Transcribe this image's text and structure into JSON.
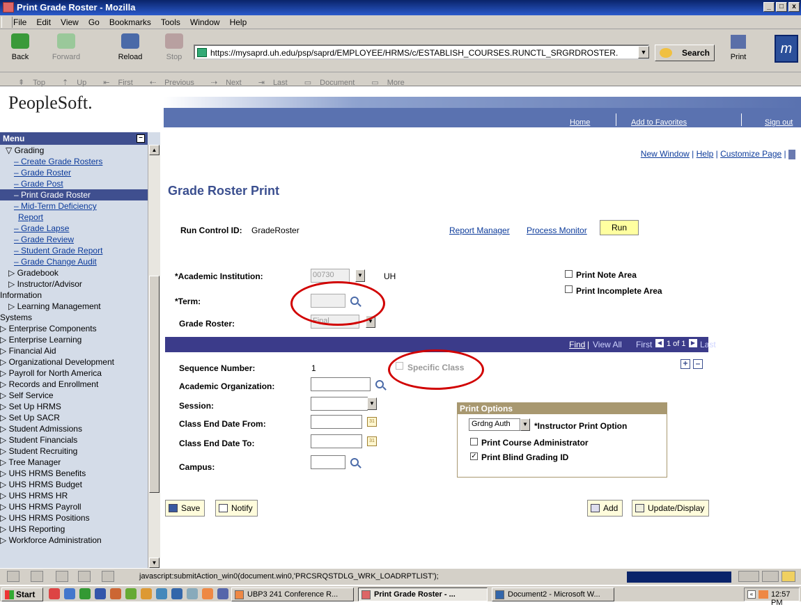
{
  "window": {
    "title": "Print Grade Roster - Mozilla",
    "controls": [
      "_",
      "□",
      "x"
    ]
  },
  "menubar": [
    "File",
    "Edit",
    "View",
    "Go",
    "Bookmarks",
    "Tools",
    "Window",
    "Help"
  ],
  "nav": {
    "back": "Back",
    "forward": "Forward",
    "reload": "Reload",
    "stop": "Stop",
    "url": "https://mysaprd.uh.edu/psp/saprd/EMPLOYEE/HRMS/c/ESTABLISH_COURSES.RUNCTL_SRGRDROSTER.",
    "search": "Search",
    "print": "Print"
  },
  "sitenav": [
    "Top",
    "Up",
    "First",
    "Previous",
    "Next",
    "Last",
    "Document",
    "More"
  ],
  "ps": {
    "logo": "PeopleSoft.",
    "home": "Home",
    "favorites": "Add to Favorites",
    "signout": "Sign out"
  },
  "menu": {
    "title": "Menu",
    "items": [
      {
        "label": "▽ Grading",
        "indent": 8,
        "type": "folder"
      },
      {
        "label": "– Create Grade Rosters",
        "indent": 20,
        "type": "link"
      },
      {
        "label": "– Grade Roster",
        "indent": 20,
        "type": "link"
      },
      {
        "label": "– Grade Post",
        "indent": 20,
        "type": "link"
      },
      {
        "label": "– Print Grade Roster",
        "indent": 20,
        "type": "selected"
      },
      {
        "label": "– Mid-Term Deficiency",
        "indent": 20,
        "type": "link"
      },
      {
        "label": "Report",
        "indent": 26,
        "type": "link"
      },
      {
        "label": "– Grade Lapse",
        "indent": 20,
        "type": "link"
      },
      {
        "label": "– Grade Review",
        "indent": 20,
        "type": "link"
      },
      {
        "label": "– Student Grade Report",
        "indent": 20,
        "type": "link"
      },
      {
        "label": "– Grade Change Audit",
        "indent": 20,
        "type": "link"
      },
      {
        "label": "▷ Gradebook",
        "indent": 12,
        "type": "folder"
      },
      {
        "label": "▷ Instructor/Advisor",
        "indent": 12,
        "type": "folder"
      },
      {
        "label": "Information",
        "indent": 0,
        "type": "folder"
      },
      {
        "label": "▷ Learning Management",
        "indent": 12,
        "type": "folder"
      },
      {
        "label": "Systems",
        "indent": 0,
        "type": "folder"
      },
      {
        "label": "▷ Enterprise Components",
        "indent": 0,
        "type": "folder"
      },
      {
        "label": "▷ Enterprise Learning",
        "indent": 0,
        "type": "folder"
      },
      {
        "label": "▷ Financial Aid",
        "indent": 0,
        "type": "folder"
      },
      {
        "label": "▷ Organizational Development",
        "indent": 0,
        "type": "folder"
      },
      {
        "label": "▷ Payroll for North America",
        "indent": 0,
        "type": "folder"
      },
      {
        "label": "▷ Records and Enrollment",
        "indent": 0,
        "type": "folder"
      },
      {
        "label": "▷ Self Service",
        "indent": 0,
        "type": "folder"
      },
      {
        "label": "▷ Set Up HRMS",
        "indent": 0,
        "type": "folder"
      },
      {
        "label": "▷ Set Up SACR",
        "indent": 0,
        "type": "folder"
      },
      {
        "label": "▷ Student Admissions",
        "indent": 0,
        "type": "folder"
      },
      {
        "label": "▷ Student Financials",
        "indent": 0,
        "type": "folder"
      },
      {
        "label": "▷ Student Recruiting",
        "indent": 0,
        "type": "folder"
      },
      {
        "label": "▷ Tree Manager",
        "indent": 0,
        "type": "folder"
      },
      {
        "label": "▷ UHS HRMS Benefits",
        "indent": 0,
        "type": "folder"
      },
      {
        "label": "▷ UHS HRMS Budget",
        "indent": 0,
        "type": "folder"
      },
      {
        "label": "▷ UHS HRMS HR",
        "indent": 0,
        "type": "folder"
      },
      {
        "label": "▷ UHS HRMS Payroll",
        "indent": 0,
        "type": "folder"
      },
      {
        "label": "▷ UHS HRMS Positions",
        "indent": 0,
        "type": "folder"
      },
      {
        "label": "▷ UHS Reporting",
        "indent": 0,
        "type": "folder"
      },
      {
        "label": "▷ Workforce Administration",
        "indent": 0,
        "type": "folder"
      }
    ]
  },
  "page": {
    "toplinks": {
      "new_window": "New Window",
      "help": "Help",
      "customize": "Customize Page",
      "sep": "|"
    },
    "title": "Grade Roster Print",
    "run_control_label": "Run Control ID:",
    "run_control_value": "GradeRoster",
    "report_manager": "Report Manager",
    "process_monitor": "Process Monitor",
    "run": "Run",
    "institution_label": "*Academic Institution:",
    "institution_value": "00730",
    "institution_desc": "UH",
    "term_label": "*Term:",
    "term_value": "",
    "roster_label": "Grade Roster:",
    "roster_value": "Final",
    "print_note": "Print Note Area",
    "print_incomplete": "Print Incomplete Area",
    "grid": {
      "find": "Find",
      "view_all": "View All",
      "first": "First",
      "count": "1 of 1",
      "last": "Last",
      "sep": "|"
    },
    "sequence_label": "Sequence Number:",
    "sequence_value": "1",
    "specific_class": "Specific Class",
    "org_label": "Academic Organization:",
    "session_label": "Session:",
    "end_from_label": "Class End Date From:",
    "end_to_label": "Class End Date To:",
    "campus_label": "Campus:",
    "print_options": {
      "title": "Print Options",
      "instructor_value": "Grdng Auth",
      "instructor_label": "*Instructor Print Option",
      "course_admin": "Print Course Administrator",
      "blind_id": "Print Blind Grading ID",
      "blind_checked": true
    },
    "save": "Save",
    "notify": "Notify",
    "add": "Add",
    "update": "Update/Display"
  },
  "status": {
    "text": "javascript:submitAction_win0(document.win0,'PRCSRQSTDLG_WRK_LOADRPTLIST');"
  },
  "taskbar": {
    "start": "Start",
    "tasks": [
      "UBP3 241 Conference R...",
      "Print Grade Roster - ...",
      "Document2 - Microsoft W..."
    ],
    "clock": "12:57 PM"
  }
}
